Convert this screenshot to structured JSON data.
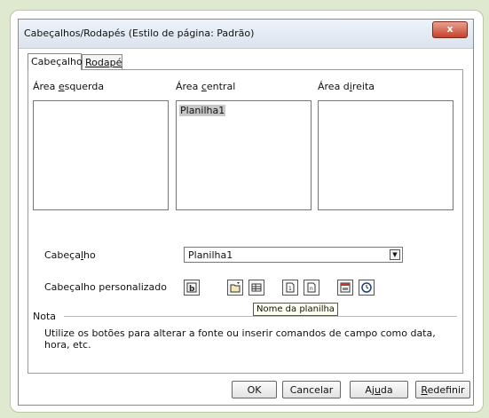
{
  "dialog": {
    "title": "Cabeçalhos/Rodapés (Estilo de página: Padrão)",
    "close_label": "x"
  },
  "tabs": [
    {
      "label": "Cabeçalho"
    },
    {
      "label": "Rodapé"
    }
  ],
  "areas": {
    "left": {
      "label_pre": "Área ",
      "label_ul": "e",
      "label_post": "squerda",
      "content": ""
    },
    "center": {
      "label_pre": "Área ",
      "label_ul": "c",
      "label_post": "entral",
      "content": "Planilha1"
    },
    "right": {
      "label_pre": "Área d",
      "label_ul": "i",
      "label_post": "reita",
      "content": ""
    }
  },
  "header_row": {
    "label_pre": "Cabeça",
    "label_ul": "l",
    "label_post": "ho",
    "selected": "Planilha1"
  },
  "custom_row": {
    "label": "Cabeçalho personalizado",
    "icons": [
      "text-attributes-icon",
      "file-name-icon",
      "sheet-name-icon",
      "page-icon",
      "pages-icon",
      "date-icon",
      "time-icon"
    ]
  },
  "tooltip": "Nome da planilha",
  "nota": {
    "label": "Nota",
    "text": "Utilize os botões para alterar a fonte ou inserir comandos de campo como data, hora, etc."
  },
  "buttons": {
    "ok": "OK",
    "cancel": "Cancelar",
    "help_pre": "Aj",
    "help_ul": "u",
    "help_post": "da",
    "reset_ul": "R",
    "reset_post": "edefinir"
  }
}
